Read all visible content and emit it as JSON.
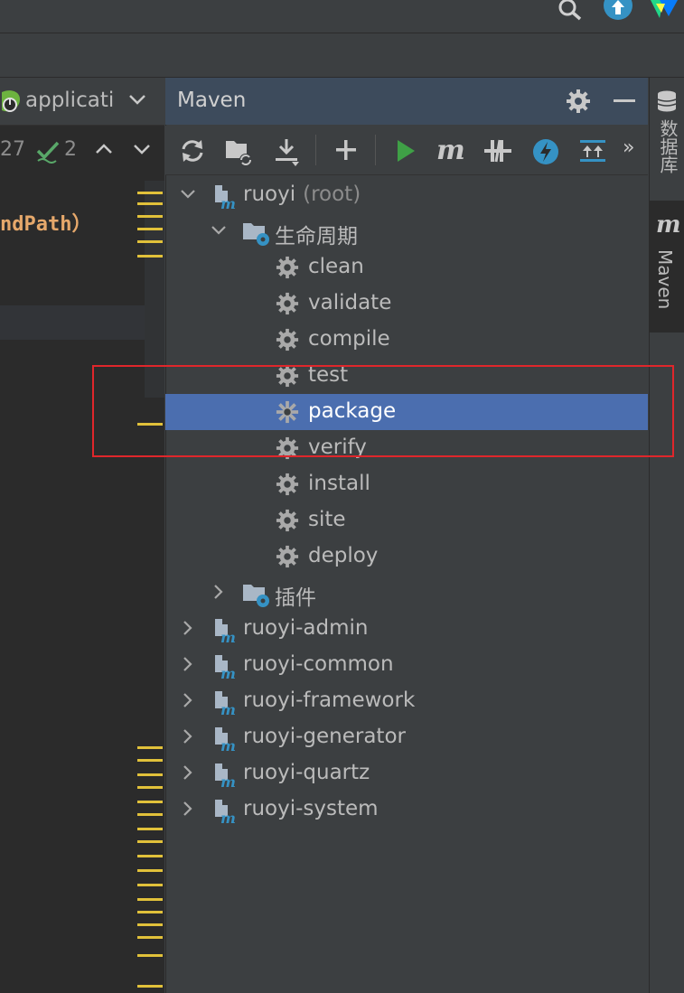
{
  "colors": {
    "selection": "#4b6eaf",
    "accent_red": "#e0262b",
    "marker_yellow": "#e1c13a",
    "run_green": "#3fa046"
  },
  "editor": {
    "tab_label": "applicati",
    "warning_count": "27",
    "check_count": "2",
    "code_snippet": "ndPath）"
  },
  "maven": {
    "title": "Maven",
    "tree": {
      "root": {
        "name": "ruoyi",
        "suffix": "(root)"
      },
      "lifecycle": {
        "label": "生命周期",
        "phases": [
          "clean",
          "validate",
          "compile",
          "test",
          "package",
          "verify",
          "install",
          "site",
          "deploy"
        ],
        "selected": "package"
      },
      "plugins_label": "插件",
      "modules": [
        "ruoyi-admin",
        "ruoyi-common",
        "ruoyi-framework",
        "ruoyi-generator",
        "ruoyi-quartz",
        "ruoyi-system"
      ]
    }
  },
  "right_strip": {
    "database_label": "数据库",
    "maven_label": "Maven"
  }
}
